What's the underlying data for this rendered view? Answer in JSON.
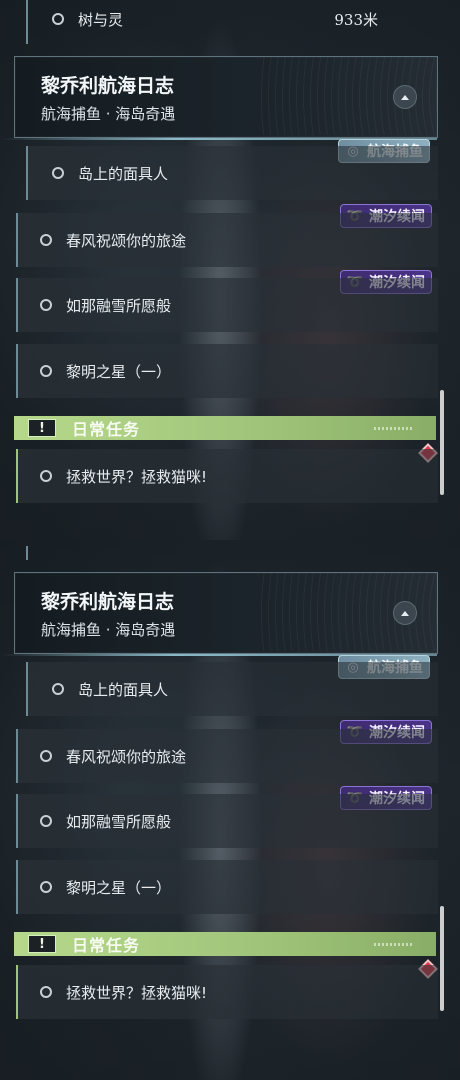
{
  "top": {
    "prev_quest": {
      "label": "树与灵",
      "distance": "933米"
    },
    "header": {
      "title": "黎乔利航海日志",
      "subtitle": "航海捕鱼 · 海岛奇遇"
    },
    "badges": {
      "fishing": "航海捕鱼",
      "tide1": "潮汐续闻",
      "tide2": "潮汐续闻"
    },
    "quests": [
      "岛上的面具人",
      "春风祝颂你的旅途",
      "如那融雪所愿般",
      "黎明之星（一）"
    ],
    "daily": {
      "title": "日常任务",
      "quest": "拯救世界？拯救猫咪!"
    }
  },
  "bottom": {
    "header": {
      "title": "黎乔利航海日志",
      "subtitle": "航海捕鱼 · 海岛奇遇"
    },
    "badges": {
      "fishing": "航海捕鱼",
      "tide1": "潮汐续闻",
      "tide2": "潮汐续闻"
    },
    "quests": [
      "岛上的面具人",
      "春风祝颂你的旅途",
      "如那融雪所愿般",
      "黎明之星（一）"
    ],
    "daily": {
      "title": "日常任务",
      "quest": "拯救世界？拯救猫咪!"
    }
  },
  "icons": {
    "fishing": "fish-swirl-icon",
    "tide": "tide-swirl-icon",
    "daily": "exclamation-icon",
    "marker": "diamond-marker-icon",
    "collapse": "chevron-up-icon",
    "radio": "radio-circle-icon"
  },
  "colors": {
    "fishing_badge": "#8eb0c0",
    "tide_badge": "#4a3388",
    "daily_bar": "#b6d88b",
    "marker": "#d83a4a"
  }
}
